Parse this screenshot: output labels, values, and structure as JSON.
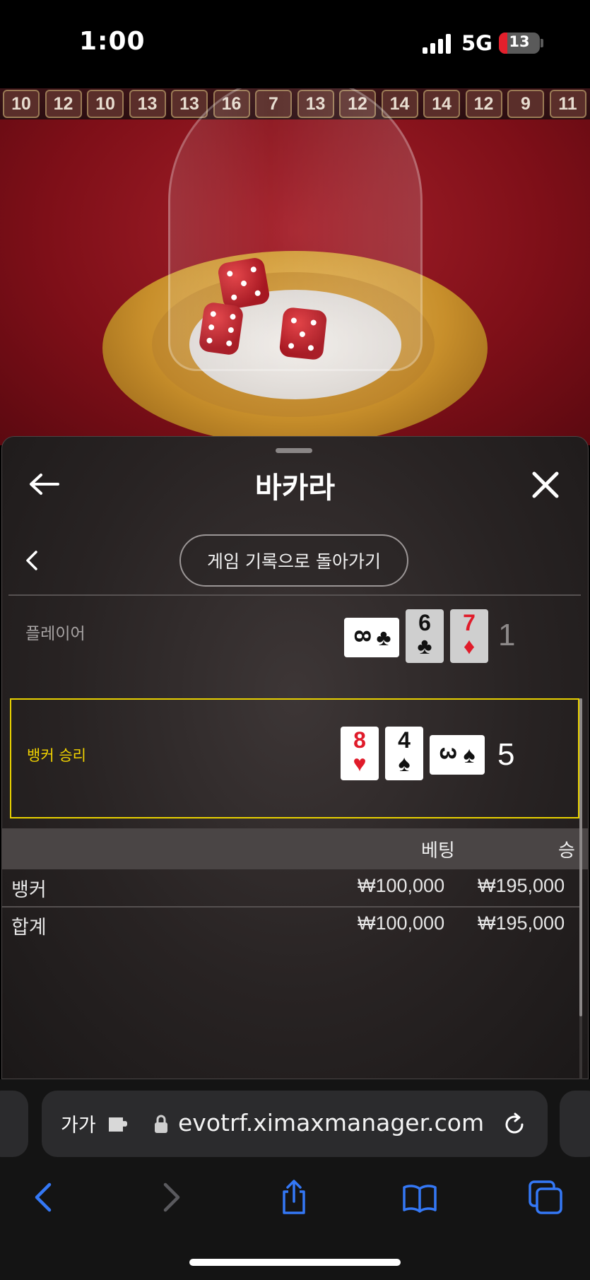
{
  "status": {
    "time": "1:00",
    "network": "5G",
    "battery": "13",
    "battery_fraction": 0.13
  },
  "roadmap": [
    "10",
    "12",
    "10",
    "13",
    "13",
    "16",
    "7",
    "13",
    "12",
    "14",
    "14",
    "12",
    "9",
    "11"
  ],
  "panel": {
    "title": "바카라",
    "history_button": "게임 기록으로 돌아가기",
    "player": {
      "label": "플레이어",
      "score": "1",
      "cards": [
        {
          "rank": "8",
          "suit": "♣",
          "color": "#111111",
          "orientation": "sideways"
        },
        {
          "rank": "6",
          "suit": "♣",
          "color": "#111111",
          "orientation": "upright"
        },
        {
          "rank": "7",
          "suit": "♦",
          "color": "#e01b2a",
          "orientation": "upright"
        }
      ]
    },
    "banker": {
      "label": "뱅커 승리",
      "score": "5",
      "cards": [
        {
          "rank": "8",
          "suit": "♥",
          "color": "#e01b2a",
          "orientation": "upright"
        },
        {
          "rank": "4",
          "suit": "♠",
          "color": "#111111",
          "orientation": "upright"
        },
        {
          "rank": "3",
          "suit": "♠",
          "color": "#111111",
          "orientation": "sideways"
        }
      ]
    },
    "table": {
      "headers": {
        "bet": "베팅",
        "win": "승"
      },
      "rows": [
        {
          "name": "뱅커",
          "bet": "₩100,000",
          "win": "₩195,000"
        }
      ],
      "total": {
        "name": "합계",
        "bet": "₩100,000",
        "win": "₩195,000"
      }
    },
    "winner_highlight_color": "#e8d100"
  },
  "browser": {
    "aa_label": "가가",
    "url": "evotrf.ximaxmanager.com",
    "accent": "#3478f6"
  },
  "icons": [
    "back-arrow-icon",
    "close-icon",
    "chevron-left-icon",
    "extension-icon",
    "lock-icon",
    "reload-icon",
    "nav-back-icon",
    "nav-forward-icon",
    "share-icon",
    "bookmarks-icon",
    "tabs-icon"
  ]
}
